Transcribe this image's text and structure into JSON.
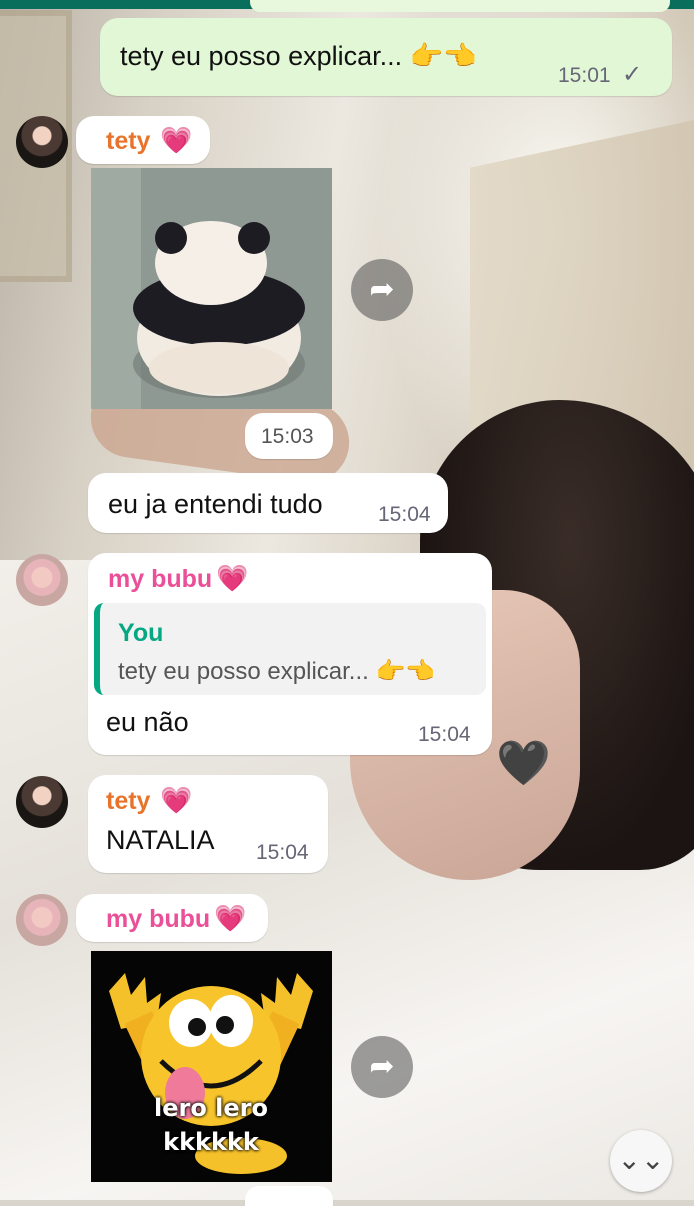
{
  "messages": [
    {
      "id": "m1",
      "direction": "outgoing",
      "text": "tety eu posso explicar... 👉👈",
      "time": "15:01",
      "status": "✓"
    },
    {
      "id": "m2",
      "direction": "incoming",
      "sender": "tety",
      "sender_emoji": "💗",
      "type": "sticker",
      "sticker_name": "panda-sticker",
      "time": "15:03"
    },
    {
      "id": "m3",
      "direction": "incoming",
      "text": "eu ja entendi tudo",
      "time": "15:04"
    },
    {
      "id": "m4",
      "direction": "incoming",
      "sender": "my bubu",
      "sender_emoji": "💗",
      "quote": {
        "author": "You",
        "text": "tety eu posso explicar... 👉👈"
      },
      "text": "eu não",
      "time": "15:04"
    },
    {
      "id": "m5",
      "direction": "incoming",
      "sender": "tety",
      "sender_emoji": "💗",
      "text": "NATALIA",
      "time": "15:04"
    },
    {
      "id": "m6",
      "direction": "incoming",
      "sender": "my bubu",
      "sender_emoji": "💗",
      "type": "sticker",
      "sticker_name": "lero-lero-sticker",
      "sticker_text": "lero lero\nkkkkkk"
    }
  ],
  "colors": {
    "outgoing_bubble": "#e2f7d6",
    "incoming_bubble": "#ffffff",
    "tety_name": "#e8742b",
    "bubu_name": "#ea4f97",
    "quote_accent": "#06a884"
  },
  "icons": {
    "forward": "share-arrow-icon",
    "scroll_down": "double-chevron-down-icon",
    "read_status": "check-icon"
  }
}
